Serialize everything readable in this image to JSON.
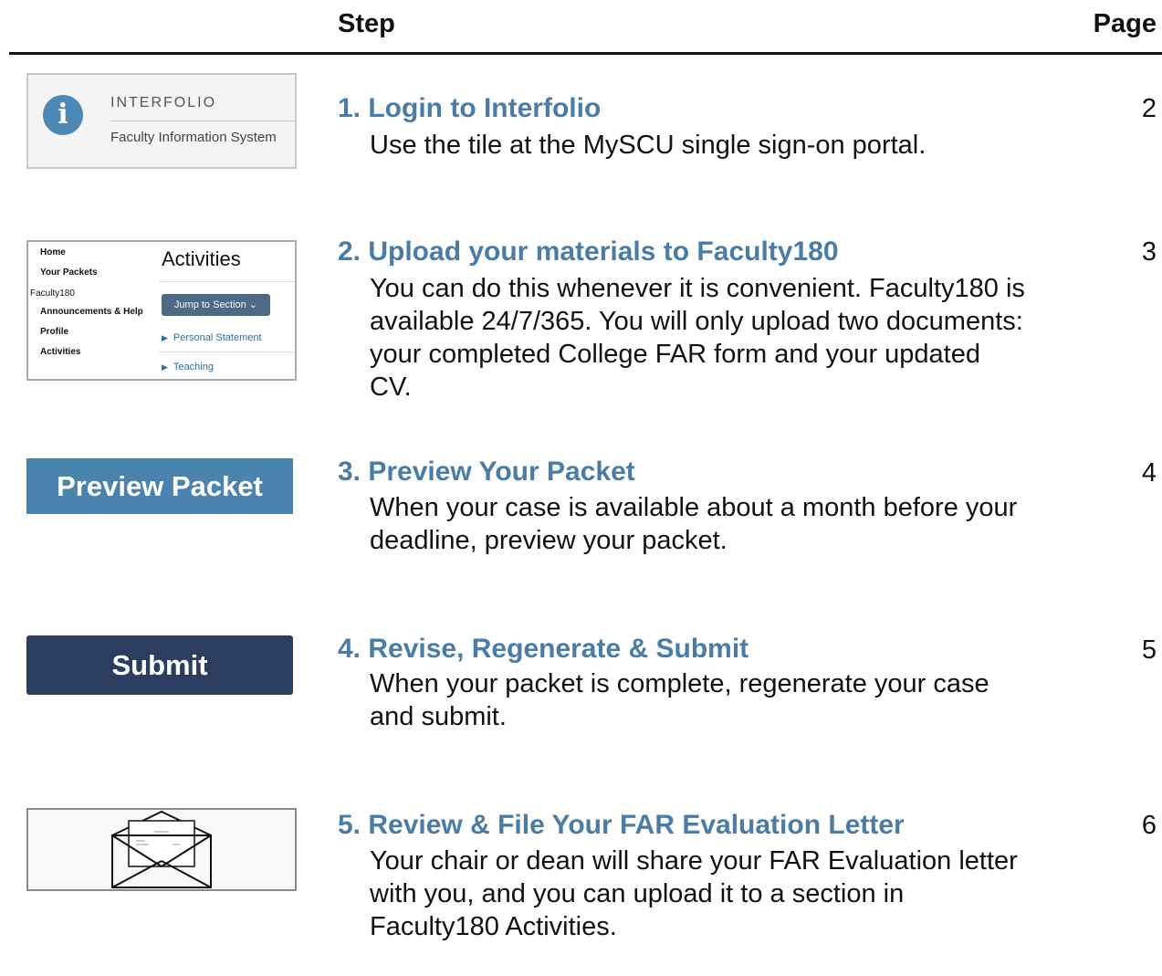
{
  "header": {
    "step_label": "Step",
    "page_label": "Page"
  },
  "steps": [
    {
      "title": "1. Login to Interfolio",
      "description": "Use the tile at the MySCU single sign-on portal.",
      "page": "2"
    },
    {
      "title": "2. Upload your materials to Faculty180",
      "description": "You can do this whenever it is convenient. Faculty180 is available 24/7/365. You will only upload two documents: your completed College FAR form and your updated CV.",
      "page": "3"
    },
    {
      "title": "3. Preview Your Packet",
      "description": "When your case is available about a month before your deadline, preview your packet.",
      "page": "4"
    },
    {
      "title": "4. Revise, Regenerate & Submit",
      "description": "When your packet is complete, regenerate your case and submit.",
      "page": "5"
    },
    {
      "title": "5. Review & File Your FAR Evaluation Letter",
      "description": "Your chair or dean will share your FAR Evaluation letter with you, and you can upload it to a section in Faculty180 Activities.",
      "page": "6"
    }
  ],
  "interfolio_tile": {
    "icon": "info-icon",
    "brand": "INTERFOLIO",
    "subtitle": "Faculty Information System"
  },
  "faculty180_nav": {
    "items": [
      "Home",
      "Your Packets",
      "Faculty180",
      "Announcements & Help",
      "Profile",
      "Activities"
    ],
    "heading": "Activities",
    "jump_button": "Jump to Section",
    "sections": [
      "Personal Statement",
      "Teaching"
    ]
  },
  "preview_button": "Preview Packet",
  "submit_button": "Submit",
  "envelope_icon": "envelope-letter-icon",
  "colors": {
    "title_blue": "#4a7ca8",
    "preview_blue": "#4a83ad",
    "submit_navy": "#2c3e60",
    "jump_button": "#4d6985",
    "link_blue": "#2f6ea1"
  }
}
